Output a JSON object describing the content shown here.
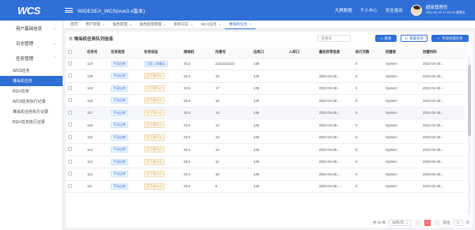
{
  "header": {
    "logo": "WCS",
    "app_title": "WIDESEA_WCS(vue3.x版本)",
    "links": [
      "大屏数据",
      "个人中心",
      "安全退出"
    ],
    "user_name": "超级管理员",
    "user_time": "2022-05-30 17:00:32 星期五",
    "color": "#2f6fd6"
  },
  "sidebar": {
    "groups": [
      {
        "label": "用户基础信息",
        "expanded": false
      },
      {
        "label": "日志管理",
        "expanded": false
      },
      {
        "label": "任务管理",
        "expanded": true
      }
    ],
    "sub_items": [
      "WCS任务",
      "堆垛机任务",
      "RGV任务",
      "WCS任务执行记录",
      "堆垛机任务执行记录",
      "RGV任务执行记录"
    ],
    "active_index": 1
  },
  "tabs": [
    {
      "label": "首页",
      "closable": false
    },
    {
      "label": "用户管理",
      "closable": true
    },
    {
      "label": "角色管理",
      "closable": true
    },
    {
      "label": "角色权限管理",
      "closable": true
    },
    {
      "label": "系统日志",
      "closable": true
    },
    {
      "label": "WCS任务",
      "closable": true
    },
    {
      "label": "堆垛机任务",
      "closable": true
    }
  ],
  "active_tab": 6,
  "panel": {
    "title": "堆垛机任务队列信息",
    "search_placeholder": "任务号",
    "btn_query": "查询",
    "btn_reset": "重置查询",
    "btn_manual": "手动完成任务"
  },
  "table": {
    "columns": [
      "任务号",
      "任务类型",
      "任务状态",
      "堆垛机",
      "托盘号",
      "出库口",
      "入库口",
      "最后异常信息",
      "执行次数",
      "创建者",
      "创建时间"
    ],
    "rows": [
      [
        "127",
        "手动出库",
        "已发入库确认",
        "SC2",
        "2222222222",
        "148",
        "",
        "",
        "0",
        "System",
        "2022-04-28..."
      ],
      [
        "120",
        "手动出库",
        "已下发PLC",
        "SC4",
        "18",
        "145",
        "",
        "2022-04-28...",
        "0",
        "System",
        "2022-04-28..."
      ],
      [
        "119",
        "手动出库",
        "已下发PLC",
        "SC4",
        "17",
        "145",
        "",
        "2022-04-28...",
        "0",
        "System",
        "2022-04-28..."
      ],
      [
        "118",
        "手动出库",
        "已下发PLC",
        "SC4",
        "16",
        "145",
        "",
        "2022-04-28...",
        "0",
        "System",
        "2022-04-28..."
      ],
      [
        "117",
        "手动出库",
        "已下发PLC",
        "SC4",
        "15",
        "145",
        "",
        "2022-04-28...",
        "0",
        "System",
        "2022-04-28..."
      ],
      [
        "116",
        "手动出库",
        "已下发PLC",
        "SC4",
        "14",
        "145",
        "",
        "2022-04-28...",
        "0",
        "System",
        "2022-04-28..."
      ],
      [
        "115",
        "手动出库",
        "已下发PLC",
        "SC4",
        "13",
        "145",
        "",
        "2022-04-28...",
        "0",
        "System",
        "2022-04-28..."
      ],
      [
        "114",
        "手动出库",
        "已下发PLC",
        "SC4",
        "12",
        "145",
        "",
        "2022-04-28...",
        "0",
        "System",
        "2022-04-28..."
      ],
      [
        "113",
        "手动出库",
        "已下发PLC",
        "SC4",
        "11",
        "145",
        "",
        "2022-04-28...",
        "0",
        "System",
        "2022-04-28..."
      ],
      [
        "112",
        "手动出库",
        "已下发PLC",
        "SC4",
        "10",
        "145",
        "",
        "2022-04-28...",
        "0",
        "System",
        "2022-04-28..."
      ],
      [
        "111",
        "手动出库",
        "已下发PLC",
        "SC4",
        "9",
        "145",
        "",
        "2022-04-28...",
        "0",
        "System",
        "2022-04-28..."
      ]
    ],
    "highlight_row": 4
  },
  "pager": {
    "total": "共 10 条",
    "page_size": "30条/页",
    "current_page": "1",
    "goto_label": "前往",
    "goto_value": "1",
    "page_suffix": "页"
  }
}
